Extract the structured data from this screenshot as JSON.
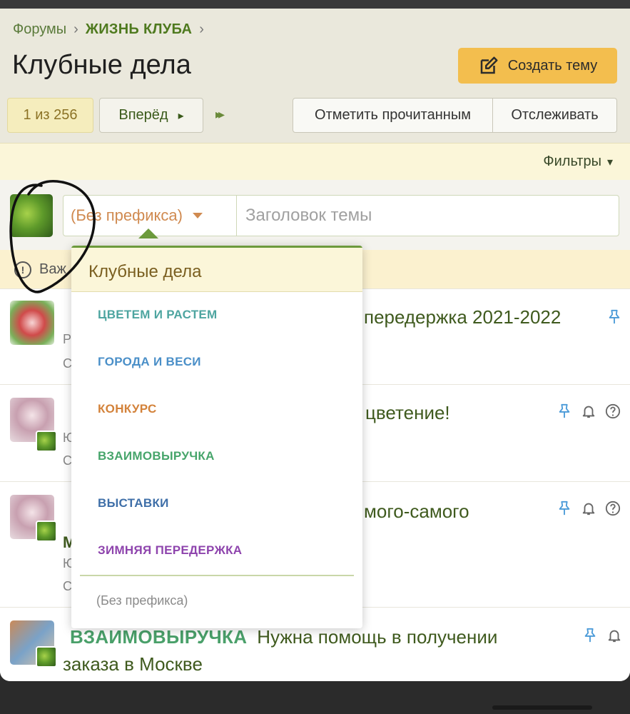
{
  "breadcrumb": {
    "forums": "Форумы",
    "section": "ЖИЗНЬ КЛУБА",
    "sep": "›"
  },
  "page_title": "Клубные дела",
  "create_button": "Создать тему",
  "pager": {
    "current": "1 из 256",
    "next": "Вперёд",
    "next_arrow": "▸",
    "last": "▸▸"
  },
  "actions": {
    "mark_read": "Отметить прочитанным",
    "watch": "Отслеживать"
  },
  "filters": {
    "label": "Фильтры",
    "caret": "▾"
  },
  "compose": {
    "prefix": "(Без префикса)",
    "title_placeholder": "Заголовок темы"
  },
  "notice": {
    "text": "Важ"
  },
  "dropdown": {
    "header": "Клубные дела",
    "items": [
      {
        "label": "ЦВЕТЕМ И РАСТЕМ",
        "color": "#4ea5a0"
      },
      {
        "label": "ГОРОДА И ВЕСИ",
        "color": "#4a8fc8"
      },
      {
        "label": "КОНКУРС",
        "color": "#d3823a"
      },
      {
        "label": "ВЗАИМОВЫРУЧКА",
        "color": "#47a56b"
      },
      {
        "label": "ВЫСТАВКИ",
        "color": "#3f6fa8"
      },
      {
        "label": "ЗИМНЯЯ ПЕРЕДЕРЖКА",
        "color": "#8e44ad"
      }
    ],
    "none": "(Без префикса)"
  },
  "threads": [
    {
      "title_visible": "передержка 2021-2022",
      "meta1": "Р",
      "meta2": "С",
      "icons": [
        "pin-icon"
      ]
    },
    {
      "title_visible": "цветение!",
      "meta1": "Ю",
      "meta2": "С",
      "icons": [
        "pin-icon",
        "bell-icon",
        "help-icon"
      ]
    },
    {
      "title_visible": "мого-самого",
      "meta0": "М",
      "meta1": "Ю",
      "meta2": "С",
      "icons": [
        "pin-icon",
        "bell-icon",
        "help-icon"
      ]
    },
    {
      "prefix": "ВЗАИМОВЫРУЧКА",
      "title_line1": "Нужна помощь в получении",
      "title_line2": "заказа в Москве",
      "icons": [
        "pin-icon",
        "bell-icon"
      ]
    }
  ],
  "colors": {
    "accent": "#f3be4e",
    "brand_green": "#4f7a1f",
    "annotation": "#111111"
  }
}
